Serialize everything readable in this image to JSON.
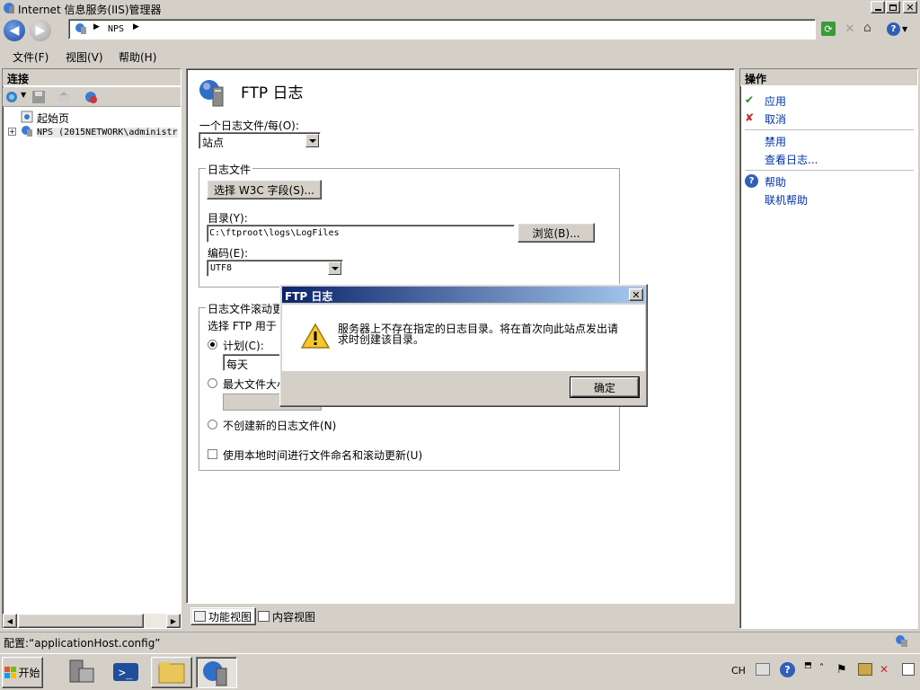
{
  "window": {
    "title": "Internet 信息服务(IIS)管理器"
  },
  "address": {
    "crumbs": [
      "NPS"
    ]
  },
  "menu": [
    {
      "label": "文件(F)"
    },
    {
      "label": "视图(V)"
    },
    {
      "label": "帮助(H)"
    }
  ],
  "connections": {
    "header": "连接",
    "tree": [
      {
        "label": "起始页"
      },
      {
        "label": "NPS (2015NETWORK\\administr"
      }
    ]
  },
  "main": {
    "title": "FTP 日志",
    "one_log_label": "一个日志文件/每(O):",
    "one_log_value": "站点",
    "logfile_group": "日志文件",
    "w3c_button": "选择 W3C 字段(S)...",
    "dir_label": "目录(Y):",
    "dir_value": "C:\\ftproot\\logs\\LogFiles",
    "browse_button": "浏览(B)...",
    "encoding_label": "编码(E):",
    "encoding_value": "UTF8",
    "rollover_group": "日志文件滚动更",
    "rollover_desc": "选择 FTP 用于",
    "schedule_label": "计划(C):",
    "schedule_value": "每天",
    "maxsize_label": "最大文件大小",
    "no_new_label": "不创建新的日志文件(N)",
    "localtime_label": "使用本地时间进行文件命名和滚动更新(U)"
  },
  "views": {
    "features": "功能视图",
    "content": "内容视图"
  },
  "actions": {
    "header": "操作",
    "items": [
      {
        "label": "应用"
      },
      {
        "label": "取消"
      },
      {
        "label": "禁用"
      },
      {
        "label": "查看日志..."
      },
      {
        "label": "帮助"
      },
      {
        "label": "联机帮助"
      }
    ]
  },
  "status": {
    "text": "配置:“applicationHost.config”"
  },
  "dialog": {
    "title": "FTP 日志",
    "message": "服务器上不存在指定的日志目录。将在首次向此站点发出请求时创建该目录。",
    "ok": "确定"
  },
  "taskbar": {
    "start": "开始",
    "lang": "CH"
  },
  "colors": {
    "titlebar": "#d4d0c8",
    "dialog_title_start": "#0a246a",
    "dialog_title_end": "#a6caf0",
    "link": "#0033aa"
  }
}
